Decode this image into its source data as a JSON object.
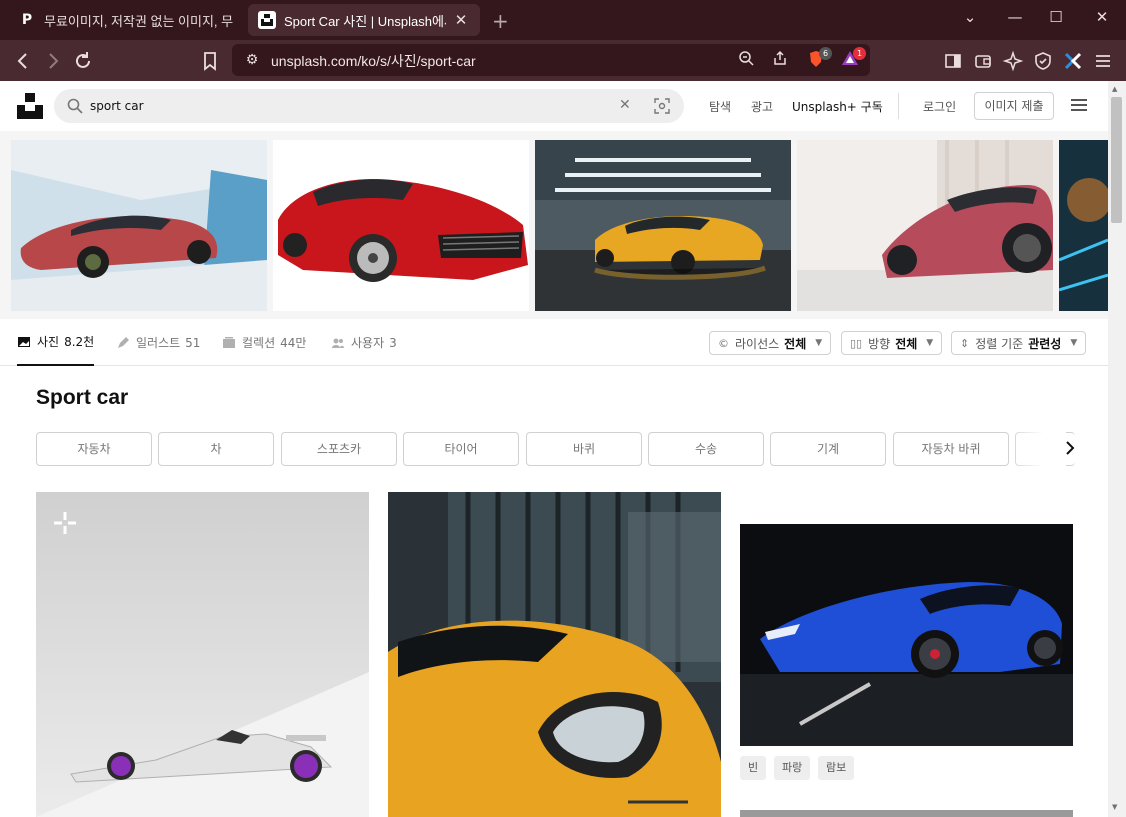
{
  "browser": {
    "tabs": [
      {
        "title": "무료이미지, 저작권 없는 이미지, 무",
        "favicon": "P"
      },
      {
        "title": "Sport Car 사진 | Unsplash에서",
        "favicon": "unsplash-logo"
      }
    ],
    "url": "unsplash.com/ko/s/사진/sport-car",
    "brave_badge": "6",
    "rewards_badge": "1"
  },
  "header": {
    "search_value": "sport car",
    "nav": [
      "탐색",
      "광고"
    ],
    "plus_label": "Unsplash+ 구독",
    "login": "로그인",
    "submit": "이미지 제출"
  },
  "content_tabs": [
    {
      "label": "사진",
      "count": "8.2천",
      "icon": "photo-icon",
      "active": true
    },
    {
      "label": "일러스트",
      "count": "51",
      "icon": "pen-icon",
      "active": false
    },
    {
      "label": "컬렉션",
      "count": "44만",
      "icon": "collection-icon",
      "active": false
    },
    {
      "label": "사용자",
      "count": "3",
      "icon": "users-icon",
      "active": false
    }
  ],
  "filters": [
    {
      "label": "라이선스",
      "value": "전체",
      "icon": "copyright-icon"
    },
    {
      "label": "방향",
      "value": "전체",
      "icon": "orientation-icon"
    },
    {
      "label": "정렬 기준",
      "value": "관련성",
      "icon": "sort-icon"
    }
  ],
  "heading": "Sport car",
  "related_chips": [
    "자동차",
    "차",
    "스포츠카",
    "타이어",
    "바퀴",
    "수송",
    "기계",
    "자동차 바퀴"
  ],
  "photo_tags": [
    "빈",
    "파랑",
    "람보"
  ],
  "colors": {
    "chrome_dark": "#33171d",
    "chrome_mid": "#4a2a31",
    "brave_orange": "#fb542b",
    "rewards_red": "#e1303c"
  }
}
